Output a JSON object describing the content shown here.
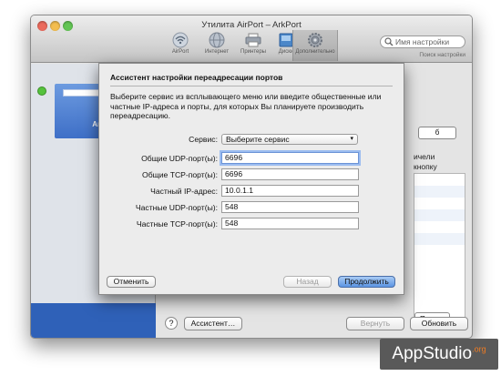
{
  "window": {
    "title": "Утилита AirPort – ArkPort"
  },
  "toolbar": {
    "items": [
      {
        "label": "AirPort",
        "icon": "airport-wifi-icon"
      },
      {
        "label": "Интернет",
        "icon": "globe-icon"
      },
      {
        "label": "Принтеры",
        "icon": "printer-icon"
      },
      {
        "label": "Диски",
        "icon": "disk-icon"
      },
      {
        "label": "Дополнительно",
        "icon": "gear-icon",
        "selected": true
      }
    ],
    "search": {
      "placeholder": "Имя настройки",
      "label": "Поиск настройки"
    }
  },
  "sidebar": {
    "device_name": "ArkPo"
  },
  "background": {
    "tab_fragment": "б",
    "text": "ичели\nкнопку",
    "edit_button": "Правка"
  },
  "bottom_bar": {
    "help": "?",
    "assistant_button": "Ассистент…",
    "revert_button": "Вернуть",
    "update_button": "Обновить"
  },
  "sheet": {
    "title": "Ассистент настройки переадресации портов",
    "description": "Выберите сервис из всплывающего меню или введите общественные или частные IP-адреса и порты, для которых Вы планируете производить переадресацию.",
    "service_label": "Сервис:",
    "service_value": "Выберите сервис",
    "fields": [
      {
        "label": "Общие UDP-порт(ы):",
        "value": "6696"
      },
      {
        "label": "Общие TCP-порт(ы):",
        "value": "6696"
      },
      {
        "label": "Частный IP-адрес:",
        "value": "10.0.1.1"
      },
      {
        "label": "Частные UDP-порт(ы):",
        "value": "548"
      },
      {
        "label": "Частные TCP-порт(ы):",
        "value": "548"
      }
    ],
    "cancel_button": "Отменить",
    "back_button": "Назад",
    "continue_button": "Продолжить"
  },
  "watermark": {
    "text": "AppStudio",
    "suffix": ".org"
  },
  "colors": {
    "accent": "#5b95e3",
    "status_online": "#55c23d",
    "sidebar_selection": "#3e6fc7"
  }
}
